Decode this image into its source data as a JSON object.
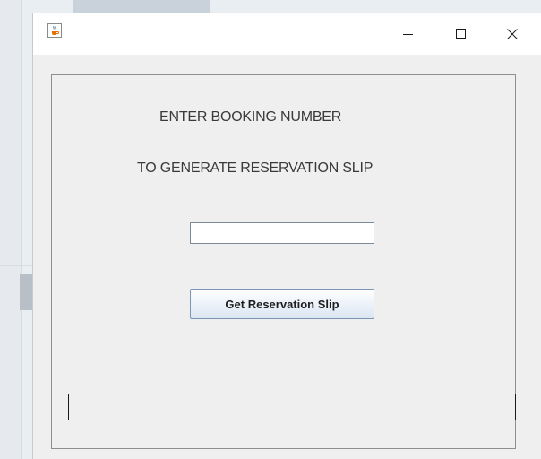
{
  "window": {
    "icon": "java-cup-icon",
    "controls": {
      "minimize_icon": "minimize-icon",
      "maximize_icon": "maximize-icon",
      "close_icon": "close-icon"
    }
  },
  "form": {
    "heading_line1": "ENTER BOOKING NUMBER",
    "heading_line2": "TO GENERATE RESERVATION SLIP",
    "booking_number_value": "",
    "submit_label": "Get Reservation Slip",
    "status_text": ""
  },
  "colors": {
    "window_bg": "#efefef",
    "titlebar_bg": "#ffffff",
    "button_border": "#7b95b3"
  }
}
